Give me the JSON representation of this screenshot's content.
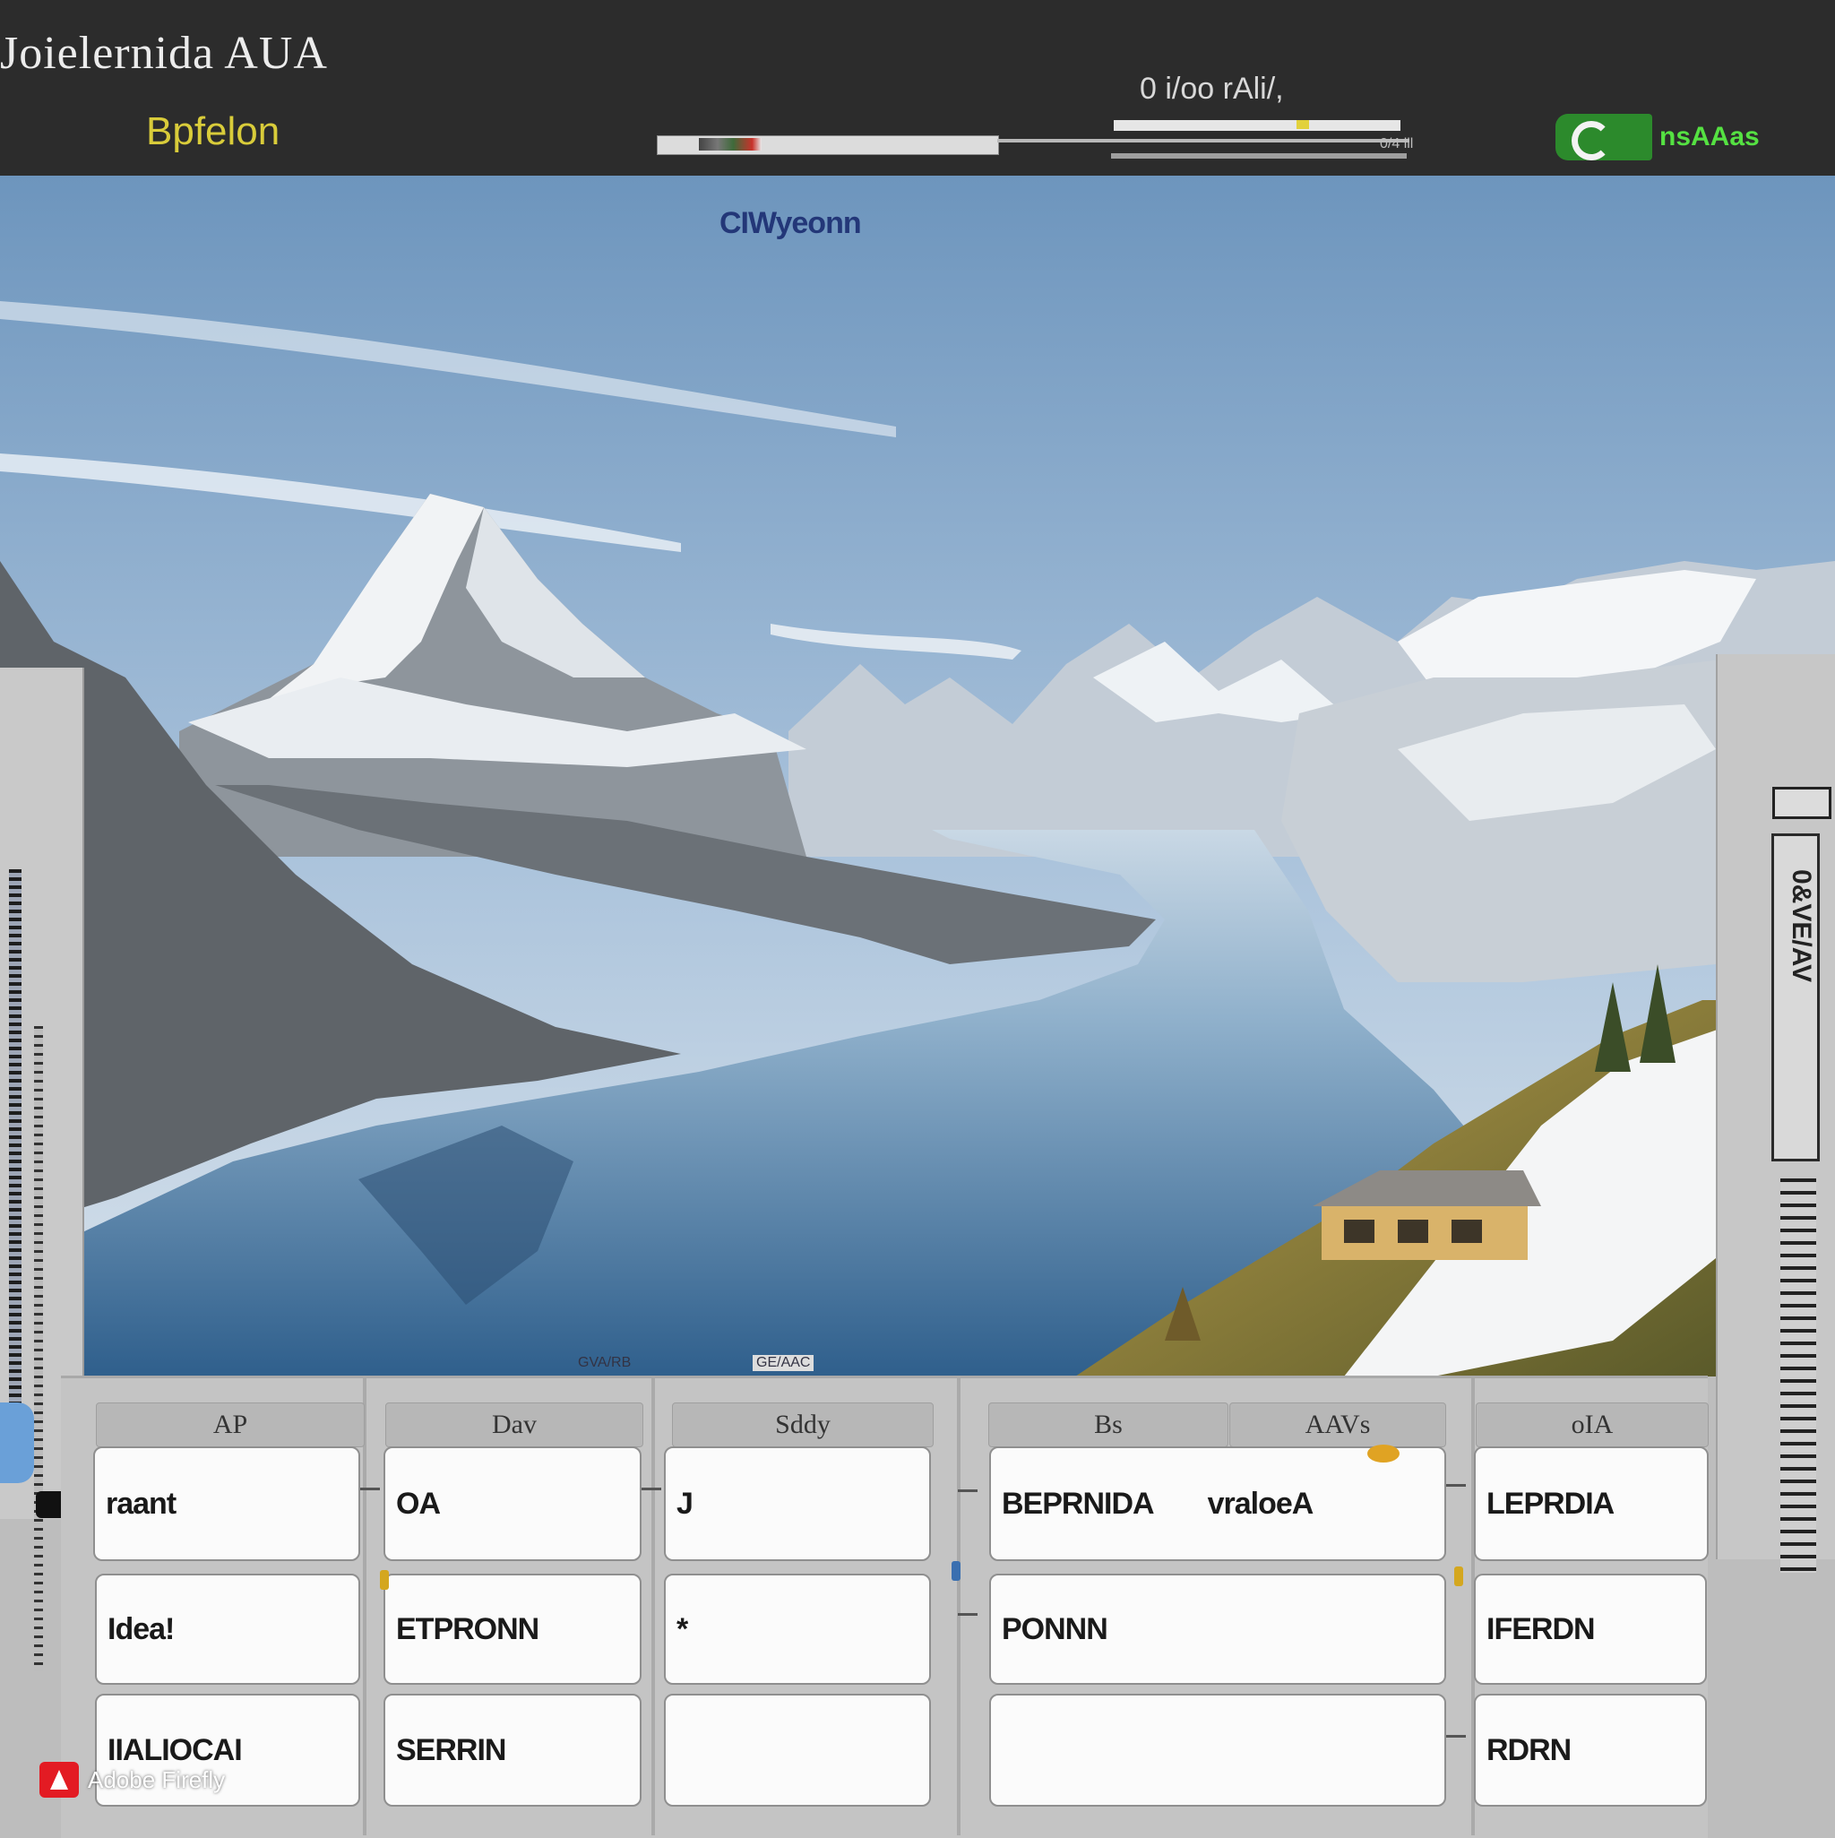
{
  "header": {
    "title": "Joielernida AUA",
    "subtitle": "Bpfelon",
    "status": "0 i/oo rAli/,",
    "readout": "0/4 lll",
    "brand_label": "nsAAas"
  },
  "scene": {
    "caption": "CIWyeonn",
    "stamp_left": "GVA/RB",
    "stamp_right": "GE/AAC",
    "side_gauge": "0&VE/AV"
  },
  "grid": {
    "headers": [
      "AP",
      "Dav",
      "Sddy",
      "Bs",
      "AAVs",
      "oIA"
    ],
    "rows": [
      [
        "raant",
        "OA",
        "J",
        "BEPRNIDA",
        "vraloeA",
        "LEPRDIA"
      ],
      [
        "Idea!",
        "ETPRONN",
        "*",
        "PONNN",
        "",
        "IFERDN"
      ],
      [
        "IIALIOCAI",
        "SERRIN",
        "",
        "",
        "",
        "RDRN"
      ]
    ]
  },
  "watermark": "Adobe Firefly",
  "colors": {
    "topbar": "#2c2c2c",
    "subtitle": "#d9cc3a",
    "brand": "#55e142",
    "sky": "#7fa4c8",
    "lake": "#3f6f9a",
    "panel": "#c4c4c4"
  }
}
